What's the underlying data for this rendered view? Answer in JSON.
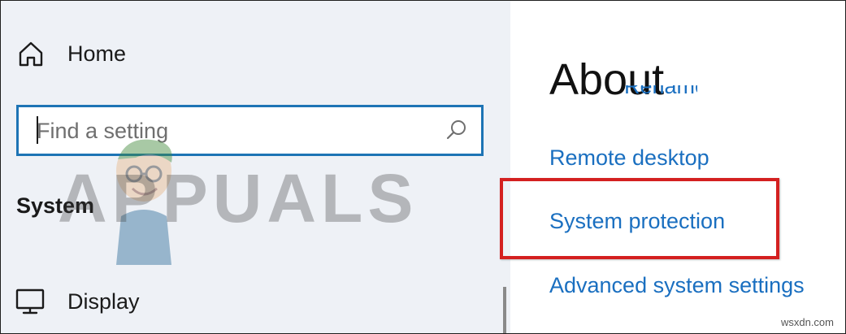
{
  "nav": {
    "home_label": "Home",
    "search": {
      "placeholder": "Find a setting",
      "value": ""
    },
    "section_heading": "System",
    "display_label": "Display"
  },
  "content": {
    "title": "About",
    "partially_hidden_link": "Rename this PC (advanced)",
    "links": {
      "remote_desktop": "Remote desktop",
      "system_protection": "System protection",
      "advanced_system_settings": "Advanced system settings"
    },
    "highlighted_item": "System protection"
  },
  "watermarks": {
    "brand": "APPUALS",
    "site": "wsxdn.com"
  },
  "colors": {
    "nav_background": "#eef1f6",
    "accent_blue": "#1d74b5",
    "link_blue": "#1a6fc0",
    "highlight_red": "#d42020",
    "text_dark": "#1a1a1a"
  },
  "icons": {
    "home": "home-icon",
    "search": "search-icon",
    "display": "monitor-icon"
  }
}
